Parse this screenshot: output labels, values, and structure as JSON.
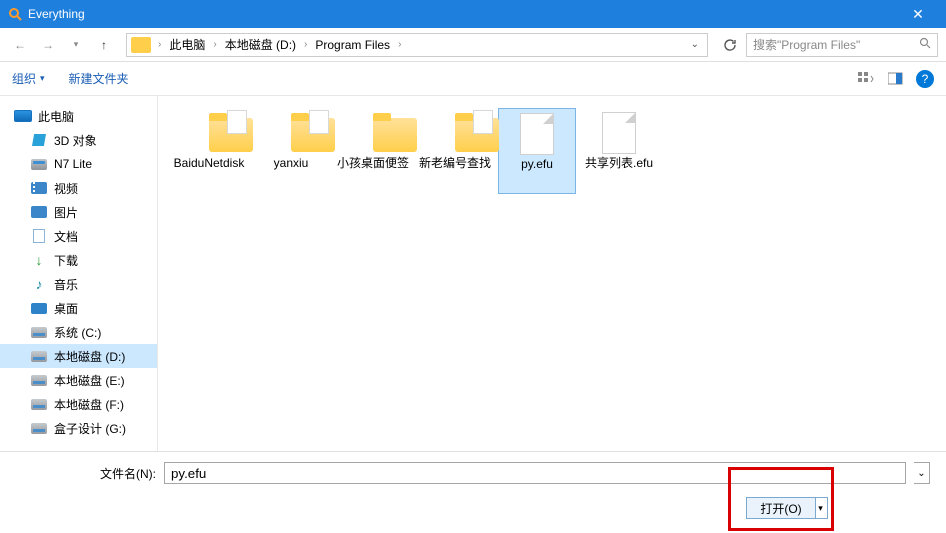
{
  "titlebar": {
    "title": "Everything"
  },
  "nav": {
    "breadcrumbs": [
      "此电脑",
      "本地磁盘 (D:)",
      "Program Files"
    ]
  },
  "search": {
    "placeholder": "搜索\"Program Files\""
  },
  "toolbar": {
    "organize": "组织",
    "newfolder": "新建文件夹"
  },
  "sidebar": {
    "pc": "此电脑",
    "items": [
      {
        "label": "3D 对象",
        "icon": "ic-3d"
      },
      {
        "label": "N7 Lite",
        "icon": "ic-disk"
      },
      {
        "label": "视频",
        "icon": "ic-video"
      },
      {
        "label": "图片",
        "icon": "ic-pic"
      },
      {
        "label": "文档",
        "icon": "ic-doc"
      },
      {
        "label": "下载",
        "icon": "ic-dl"
      },
      {
        "label": "音乐",
        "icon": "ic-music"
      },
      {
        "label": "桌面",
        "icon": "ic-desktop"
      },
      {
        "label": "系统 (C:)",
        "icon": "ic-drive"
      },
      {
        "label": "本地磁盘 (D:)",
        "icon": "ic-drive",
        "selected": true
      },
      {
        "label": "本地磁盘 (E:)",
        "icon": "ic-drive"
      },
      {
        "label": "本地磁盘 (F:)",
        "icon": "ic-drive"
      },
      {
        "label": "盒子设计 (G:)",
        "icon": "ic-drive"
      }
    ]
  },
  "files": [
    {
      "name": "BaiduNetdisk",
      "type": "folder-paper"
    },
    {
      "name": "yanxiu",
      "type": "folder-paper"
    },
    {
      "name": "小孩桌面便签",
      "type": "folder"
    },
    {
      "name": "新老编号查找",
      "type": "folder-paper"
    },
    {
      "name": "py.efu",
      "type": "file",
      "selected": true
    },
    {
      "name": "共享列表.efu",
      "type": "file"
    }
  ],
  "bottom": {
    "filename_label": "文件名(N):",
    "filename_value": "py.efu",
    "open_label": "打开(O)"
  }
}
